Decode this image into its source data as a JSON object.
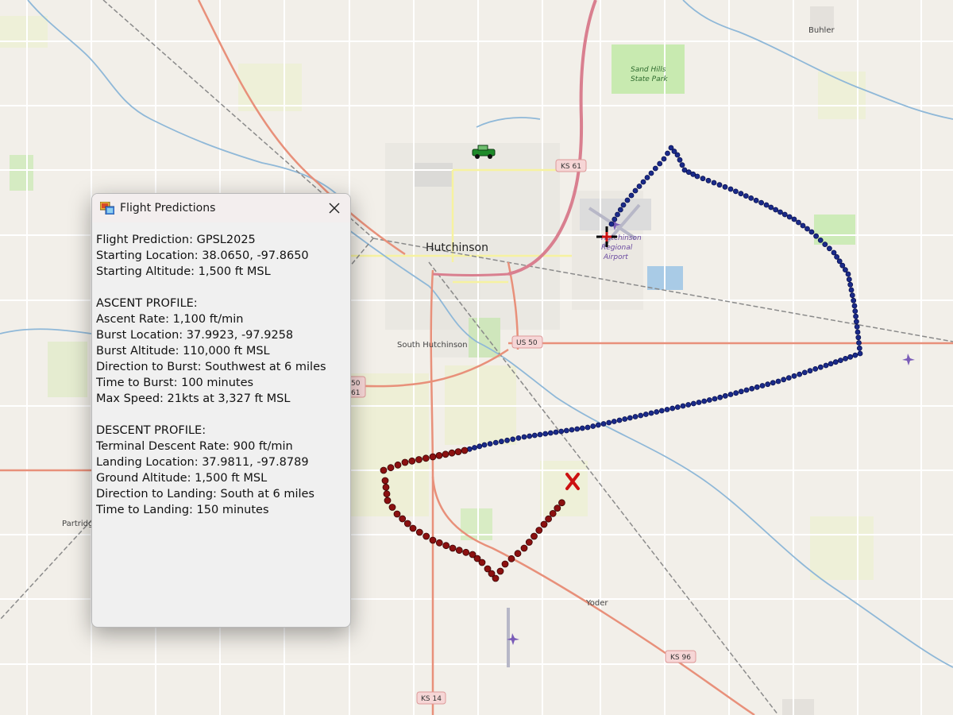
{
  "dialog": {
    "title": "Flight Predictions",
    "close_label": "×",
    "lines": [
      "Flight Prediction: GPSL2025",
      "Starting Location: 38.0650, -97.8650",
      "Starting Altitude: 1,500 ft MSL",
      "",
      "ASCENT PROFILE:",
      "Ascent Rate: 1,100 ft/min",
      "Burst Location: 37.9923, -97.9258",
      "Burst Altitude: 110,000 ft MSL",
      "Direction to Burst: Southwest at 6 miles",
      "Time to Burst: 100 minutes",
      "Max Speed: 21kts at 3,327 ft MSL",
      "",
      "DESCENT PROFILE:",
      "Terminal Descent Rate: 900 ft/min",
      "Landing Location: 37.9811, -97.8789",
      "Ground Altitude: 1,500 ft MSL",
      "Direction to Landing: South at 6 miles",
      "Time to Landing: 150 minutes"
    ]
  },
  "map": {
    "labels": {
      "hutchinson": "Hutchinson",
      "south_hutchinson": "South Hutchinson",
      "buhler": "Buhler",
      "partridge": "Partridge",
      "yoder": "Yoder",
      "park_line1": "Sand Hills",
      "park_line2": "State Park",
      "airport_line1": "Hutchinson",
      "airport_line2": "Regional",
      "airport_line3": "Airport"
    },
    "shields": {
      "ks61": "KS 61",
      "us50": "US 50",
      "ks96": "KS 96",
      "ks14": "KS 14",
      "us50_61_line1": "50",
      "us50_61_line2": "61"
    },
    "colors": {
      "ascent_track": "#1a2a8a",
      "descent_track": "#8b1010",
      "landing_marker": "#cc1111",
      "major_road": "#e8907a",
      "highway": "#d97f8f",
      "river": "#8fb8d8"
    },
    "icons": {
      "launch": "vehicle-icon",
      "burst": "crosshair-icon",
      "landing": "x-mark-icon"
    }
  }
}
